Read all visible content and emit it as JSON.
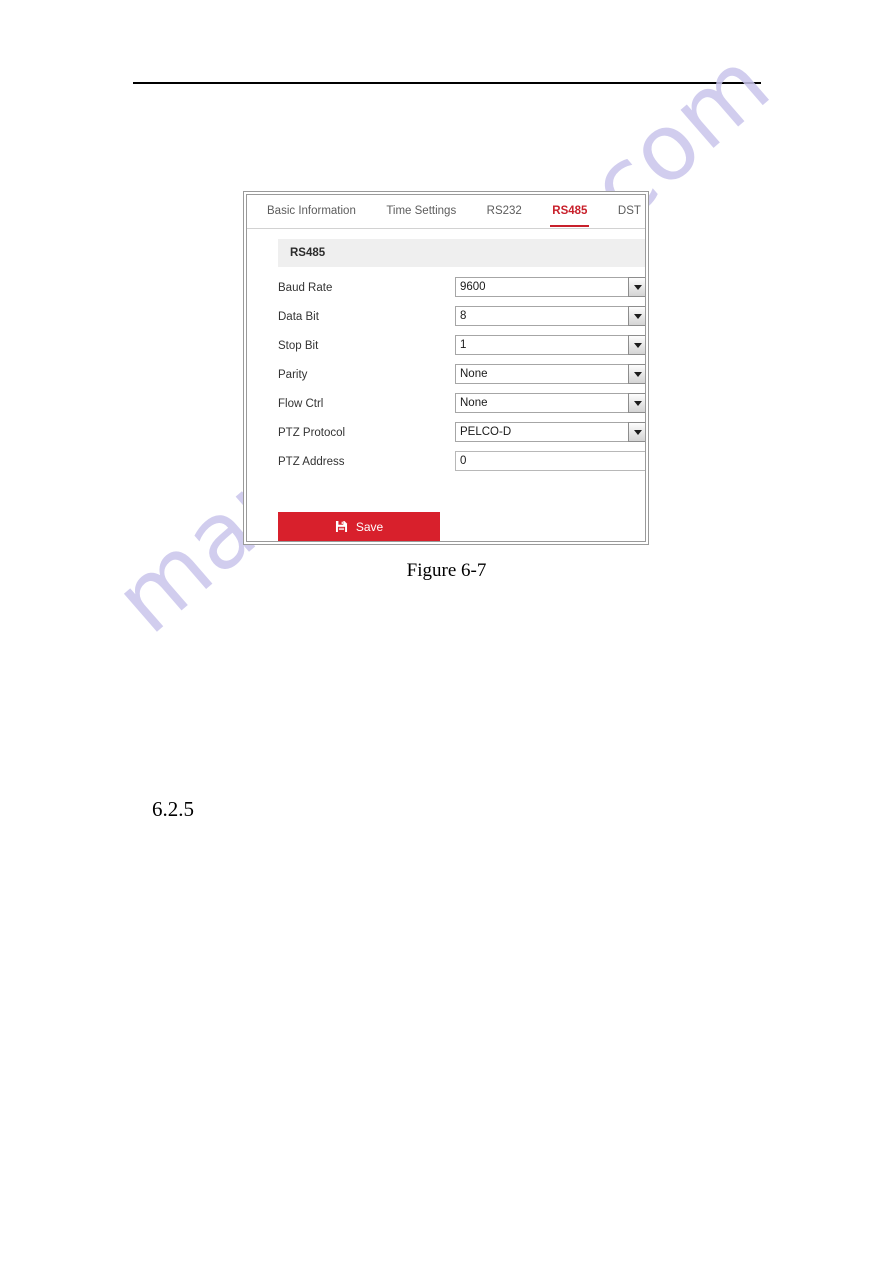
{
  "page": {
    "watermark_text": "manualshive.com",
    "watermark_color": "#c9c5ec",
    "figure_caption": "Figure 6-7",
    "section_heading": "6.2.5"
  },
  "screenshot": {
    "tabs": [
      {
        "label": "Basic Information",
        "active": false
      },
      {
        "label": "Time Settings",
        "active": false
      },
      {
        "label": "RS232",
        "active": false
      },
      {
        "label": "RS485",
        "active": true
      },
      {
        "label": "DST",
        "active": false
      }
    ],
    "section_title": "RS485",
    "accent_color": "#c8202b",
    "fields": [
      {
        "label": "Baud Rate",
        "value": "9600",
        "type": "select"
      },
      {
        "label": "Data Bit",
        "value": "8",
        "type": "select"
      },
      {
        "label": "Stop Bit",
        "value": "1",
        "type": "select"
      },
      {
        "label": "Parity",
        "value": "None",
        "type": "select"
      },
      {
        "label": "Flow Ctrl",
        "value": "None",
        "type": "select"
      },
      {
        "label": "PTZ Protocol",
        "value": "PELCO-D",
        "type": "select"
      },
      {
        "label": "PTZ Address",
        "value": "0",
        "type": "input"
      }
    ],
    "save_button": {
      "label": "Save",
      "icon": "floppy-disk-save-icon",
      "color": "#d8202c"
    }
  }
}
